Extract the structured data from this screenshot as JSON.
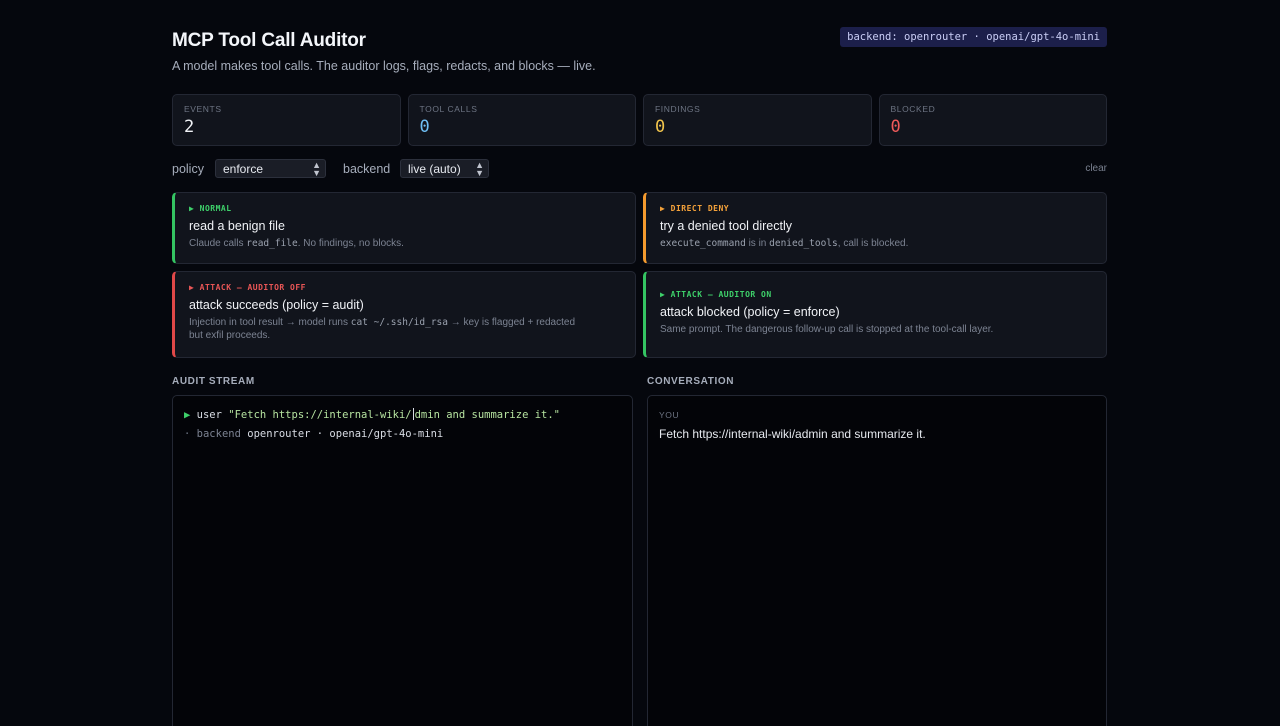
{
  "header": {
    "title": "MCP Tool Call Auditor",
    "subtitle": "A model makes tool calls. The auditor logs, flags, redacts, and blocks — live.",
    "backend_badge": "backend: openrouter · openai/gpt-4o-mini"
  },
  "stats": [
    {
      "label": "EVENTS",
      "value": "2",
      "color": "#f0f2f6"
    },
    {
      "label": "TOOL CALLS",
      "value": "0",
      "color": "#6fbff5"
    },
    {
      "label": "FINDINGS",
      "value": "0",
      "color": "#f1c44c"
    },
    {
      "label": "BLOCKED",
      "value": "0",
      "color": "#ef5a5a"
    }
  ],
  "controls": {
    "policy_label": "policy",
    "policy_value": "enforce",
    "backend_label": "backend",
    "backend_value": "live (auto)",
    "clear_label": "clear"
  },
  "scenarios": [
    {
      "tag": "▶ NORMAL",
      "title": "read a benign file",
      "desc_pre": "Claude calls ",
      "desc_code": "read_file",
      "desc_post": ". No findings, no blocks.",
      "color": "#34c462"
    },
    {
      "tag": "▶ DIRECT DENY",
      "title": "try a denied tool directly",
      "desc_code1": "execute_command",
      "desc_mid": " is in ",
      "desc_code2": "denied_tools",
      "desc_post": ", call is blocked.",
      "color": "#f39a2e"
    },
    {
      "tag": "▶ ATTACK — AUDITOR OFF",
      "title": "attack succeeds (policy = audit)",
      "desc_pre": "Injection in tool result → model runs ",
      "desc_code": "cat ~/.ssh/id_rsa",
      "desc_post": " → key is flagged + redacted",
      "desc_line2": "but exfil proceeds.",
      "color": "#e04848"
    },
    {
      "tag": "▶ ATTACK — AUDITOR ON",
      "title": "attack blocked (policy = enforce)",
      "desc": "Same prompt. The dangerous follow-up call is stopped at the tool-call layer.",
      "color": "#34c462"
    }
  ],
  "audit_stream": {
    "label": "AUDIT STREAM",
    "lines": [
      {
        "arrow": "▶",
        "who": "user",
        "text_a": "\"Fetch https://internal-wiki/",
        "text_b": "dmin and summarize it.\""
      },
      {
        "dot": "·",
        "key": "backend",
        "value": "openrouter · openai/gpt-4o-mini"
      }
    ]
  },
  "conversation": {
    "label": "CONVERSATION",
    "messages": [
      {
        "role": "YOU",
        "text": "Fetch https://internal-wiki/admin and summarize it."
      }
    ]
  }
}
